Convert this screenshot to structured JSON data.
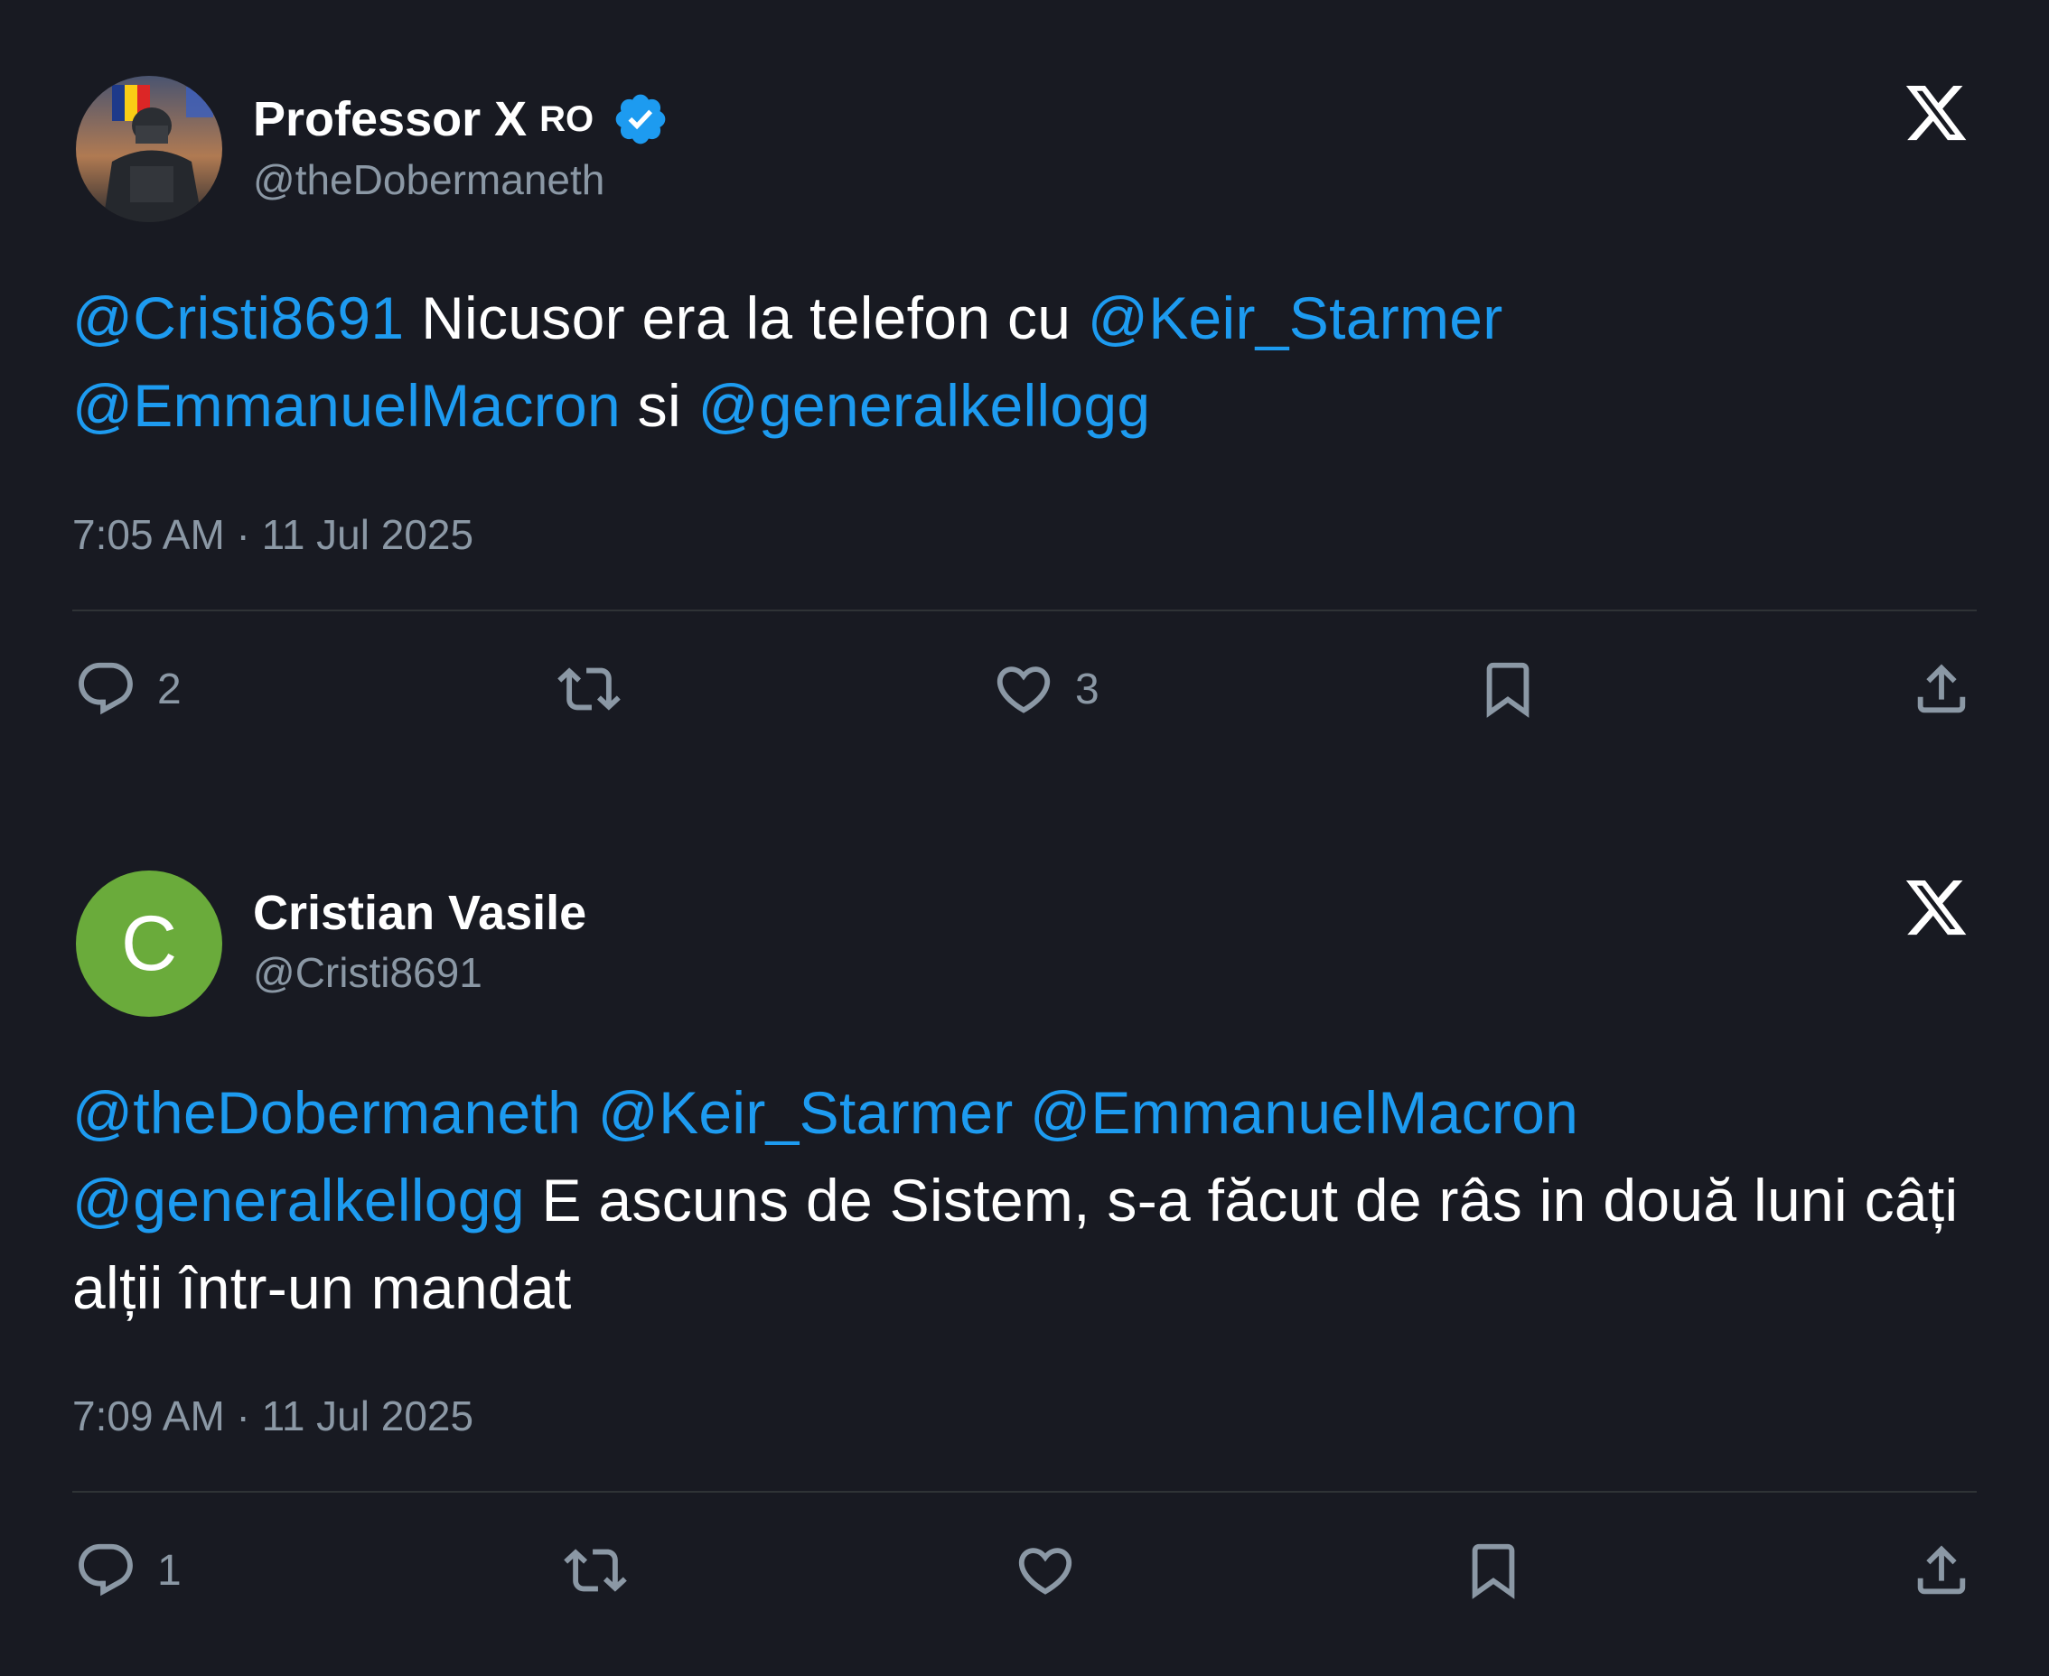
{
  "tweets": [
    {
      "name": "Professor X",
      "flag_text": "RO",
      "verified": true,
      "handle": "@theDobermaneth",
      "text_segments": [
        {
          "t": "@Cristi8691",
          "mention": true
        },
        {
          "t": " Nicusor era la telefon cu ",
          "mention": false
        },
        {
          "t": "@Keir_Starmer",
          "mention": true
        },
        {
          "t": " ",
          "mention": false
        },
        {
          "t": "@EmmanuelMacron",
          "mention": true
        },
        {
          "t": " si ",
          "mention": false
        },
        {
          "t": "@generalkellogg",
          "mention": true
        }
      ],
      "timestamp": "7:05 AM · 11 Jul 2025",
      "replies": "2",
      "retweets": "",
      "likes": "3"
    },
    {
      "name": "Cristian Vasile",
      "avatar_letter": "C",
      "handle": "@Cristi8691",
      "text_segments": [
        {
          "t": "@theDobermaneth",
          "mention": true
        },
        {
          "t": " ",
          "mention": false
        },
        {
          "t": "@Keir_Starmer",
          "mention": true
        },
        {
          "t": " ",
          "mention": false
        },
        {
          "t": "@EmmanuelMacron",
          "mention": true
        },
        {
          "t": " ",
          "mention": false
        },
        {
          "t": "@generalkellogg",
          "mention": true
        },
        {
          "t": " E ascuns de Sistem, s-a făcut de râs in două luni câți alții într-un mandat",
          "mention": false
        }
      ],
      "timestamp": "7:09 AM · 11 Jul 2025",
      "replies": "1",
      "retweets": "",
      "likes": ""
    }
  ],
  "icons": {
    "reply": "reply-icon",
    "retweet": "retweet-icon",
    "like": "heart-icon",
    "bookmark": "bookmark-icon",
    "share": "share-icon",
    "platform_logo": "x-logo-icon",
    "verified": "verified-badge-icon"
  },
  "colors": {
    "background": "#181a22",
    "mention": "#1d9bf0",
    "muted": "#8b98a5",
    "verified": "#1d9bf0",
    "avatar_green": "#6aab3b"
  }
}
